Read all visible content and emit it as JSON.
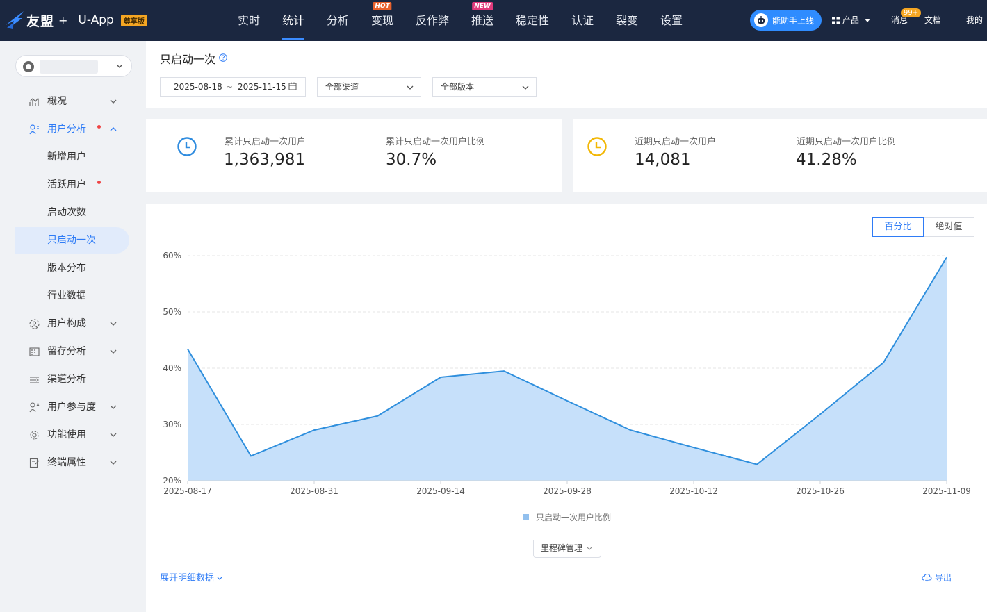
{
  "topbar": {
    "brand_name": "友盟",
    "brand_plus": "+",
    "product_name": "U-App",
    "edition_badge": "尊享版",
    "nav": [
      {
        "label": "实时",
        "active": false,
        "tag": ""
      },
      {
        "label": "统计",
        "active": true,
        "tag": ""
      },
      {
        "label": "分析",
        "active": false,
        "tag": ""
      },
      {
        "label": "变现",
        "active": false,
        "tag": "HOT"
      },
      {
        "label": "反作弊",
        "active": false,
        "tag": ""
      },
      {
        "label": "推送",
        "active": false,
        "tag": "NEW"
      },
      {
        "label": "稳定性",
        "active": false,
        "tag": ""
      },
      {
        "label": "认证",
        "active": false,
        "tag": ""
      },
      {
        "label": "裂变",
        "active": false,
        "tag": ""
      },
      {
        "label": "设置",
        "active": false,
        "tag": ""
      }
    ],
    "assistant_label": "能助手上线",
    "products_label": "产品",
    "messages_label": "消息",
    "messages_badge": "99+",
    "docs_label": "文档",
    "mine_label": "我的"
  },
  "sidebar": {
    "menu": [
      {
        "label": "概况",
        "icon": "overview-chart-icon",
        "expanded": false,
        "dot": false
      },
      {
        "label": "用户分析",
        "icon": "user-analysis-icon",
        "expanded": true,
        "dot": true,
        "children": [
          {
            "label": "新增用户",
            "active": false,
            "dot": false
          },
          {
            "label": "活跃用户",
            "active": false,
            "dot": true
          },
          {
            "label": "启动次数",
            "active": false,
            "dot": false
          },
          {
            "label": "只启动一次",
            "active": true,
            "dot": false
          },
          {
            "label": "版本分布",
            "active": false,
            "dot": false
          },
          {
            "label": "行业数据",
            "active": false,
            "dot": false
          }
        ]
      },
      {
        "label": "用户构成",
        "icon": "user-composition-icon",
        "expanded": false,
        "dot": false
      },
      {
        "label": "留存分析",
        "icon": "retention-icon",
        "expanded": false,
        "dot": false
      },
      {
        "label": "渠道分析",
        "icon": "channel-icon",
        "expanded": false,
        "dot": false
      },
      {
        "label": "用户参与度",
        "icon": "engagement-icon",
        "expanded": false,
        "dot": false
      },
      {
        "label": "功能使用",
        "icon": "feature-gear-icon",
        "expanded": false,
        "dot": false
      },
      {
        "label": "终端属性",
        "icon": "device-icon",
        "expanded": false,
        "dot": false
      }
    ]
  },
  "header": {
    "title": "只启动一次",
    "date_start": "2025-08-18",
    "date_sep": "~",
    "date_end": "2025-11-15",
    "channel_select": "全部渠道",
    "version_select": "全部版本"
  },
  "stats": {
    "cumulative": {
      "users_label": "累计只启动一次用户",
      "users_value": "1,363,981",
      "ratio_label": "累计只启动一次用户比例",
      "ratio_value": "30.7%",
      "icon_color": "#2f8cdf"
    },
    "recent": {
      "users_label": "近期只启动一次用户",
      "users_value": "14,081",
      "ratio_label": "近期只启动一次用户比例",
      "ratio_value": "41.28%",
      "icon_color": "#f2b705"
    }
  },
  "chart_controls": {
    "percent_label": "百分比",
    "absolute_label": "绝对值",
    "selected": "percent"
  },
  "chart_data": {
    "type": "area",
    "x": [
      "2025-08-17",
      "2025-08-24",
      "2025-08-31",
      "2025-09-07",
      "2025-09-14",
      "2025-09-21",
      "2025-09-28",
      "2025-10-05",
      "2025-10-12",
      "2025-10-19",
      "2025-10-26",
      "2025-11-02",
      "2025-11-09"
    ],
    "x_tick_labels": [
      "2025-08-17",
      "2025-08-31",
      "2025-09-14",
      "2025-09-28",
      "2025-10-12",
      "2025-10-26",
      "2025-11-09"
    ],
    "series": [
      {
        "name": "只启动一次用户比例",
        "values": [
          43.4,
          24.4,
          29.0,
          31.5,
          38.4,
          39.5,
          34.2,
          29.0,
          25.9,
          22.9,
          31.8,
          41.0,
          59.7
        ]
      }
    ],
    "y_unit": "%",
    "ylim": [
      20,
      60
    ],
    "y_ticks": [
      20,
      30,
      40,
      50,
      60
    ],
    "grid": true,
    "legend": "bottom-center",
    "line_color": "#2f8fdd",
    "fill_color": "#c6e0fa"
  },
  "footer": {
    "milestone_label": "里程碑管理",
    "expand_label": "展开明细数据",
    "export_label": "导出"
  }
}
